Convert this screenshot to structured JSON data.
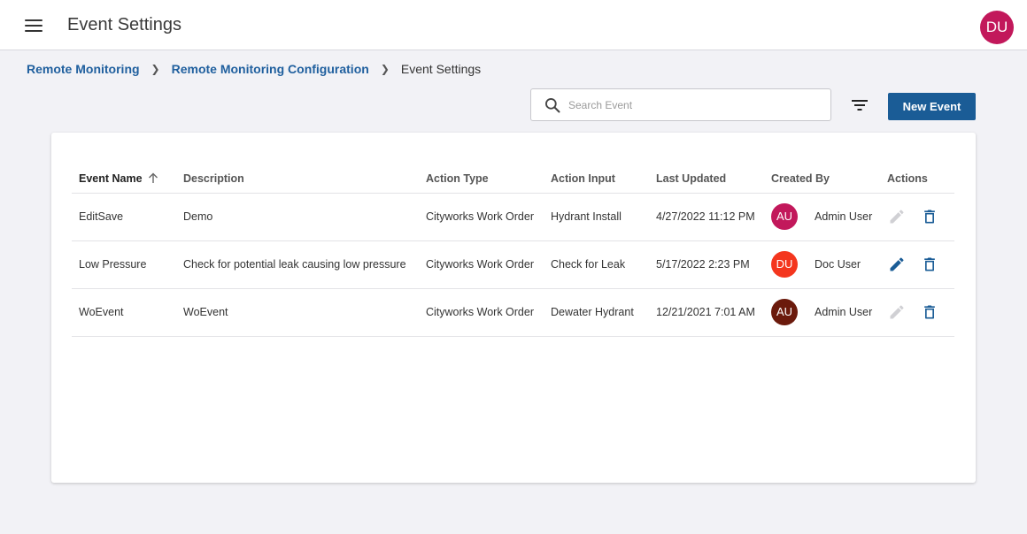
{
  "header": {
    "title": "Event Settings",
    "user_initials": "DU",
    "user_color": "#c2185b"
  },
  "breadcrumb": {
    "item1": "Remote Monitoring",
    "item2": "Remote Monitoring Configuration",
    "current": "Event Settings"
  },
  "toolbar": {
    "search_placeholder": "Search Event",
    "search_value": "",
    "new_label": "New Event",
    "accent": "#1a5c96"
  },
  "table": {
    "headers": {
      "name": "Event Name",
      "description": "Description",
      "action_type": "Action Type",
      "action_input": "Action Input",
      "last_updated": "Last Updated",
      "created_by": "Created By",
      "actions": "Actions"
    },
    "sort": {
      "column": "Event Name",
      "direction": "ascending"
    },
    "rows": [
      {
        "name": "EditSave",
        "description": "Demo",
        "action_type": "Cityworks Work Order",
        "action_input": "Hydrant Install",
        "last_updated": "4/27/2022 11:12 PM",
        "creator_initials": "AU",
        "creator_color": "#c2185b",
        "creator": "Admin User",
        "editable": false
      },
      {
        "name": "Low Pressure",
        "description": "Check for potential leak causing low pressure",
        "action_type": "Cityworks Work Order",
        "action_input": "Check for Leak",
        "last_updated": "5/17/2022 2:23 PM",
        "creator_initials": "DU",
        "creator_color": "#f4361e",
        "creator": "Doc User",
        "editable": true
      },
      {
        "name": "WoEvent",
        "description": "WoEvent",
        "action_type": "Cityworks Work Order",
        "action_input": "Dewater Hydrant",
        "last_updated": "12/21/2021 7:01 AM",
        "creator_initials": "AU",
        "creator_color": "#6b1a0c",
        "creator": "Admin User",
        "editable": false
      }
    ]
  },
  "icons": {
    "edit_enabled_color": "#1a5c96",
    "edit_disabled_color": "#d0d0d4",
    "delete_color": "#1a5c96"
  }
}
